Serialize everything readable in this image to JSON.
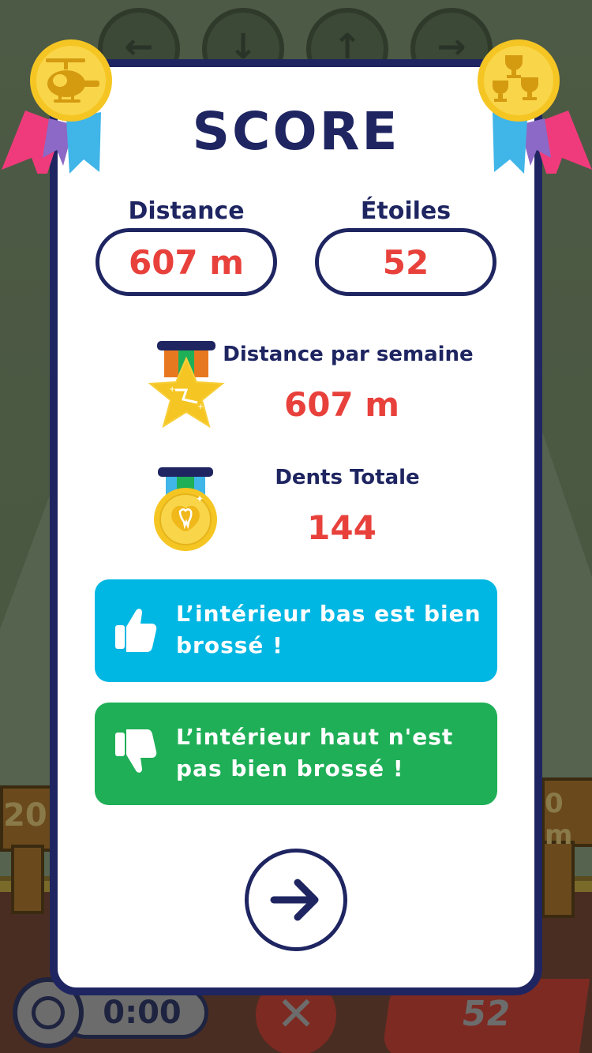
{
  "score_panel": {
    "title": "SCORE",
    "distance_label": "Distance",
    "distance_value": "607 m",
    "stars_label": "Étoiles",
    "stars_value": "52",
    "weekly_label": "Distance par semaine",
    "weekly_value": "607 m",
    "teeth_label": "Dents Totale",
    "teeth_value": "144",
    "feedback_good": "L’intérieur bas est bien brossé !",
    "feedback_bad": "L’intérieur haut n'est pas bien brossé !"
  },
  "background": {
    "timer_text": "0:00",
    "left_marker_text": "20",
    "right_marker_text": "0 m",
    "stars_banner_text": "52"
  },
  "colors": {
    "navy": "#1e2561",
    "red": "#e8413c",
    "good": "#00b7e3",
    "bad": "#1faf57",
    "gold": "#f5c623",
    "pink": "#ef3b7b",
    "blue": "#40b5e8"
  },
  "icons": {
    "left_ribbon": "helicopter-medal-icon",
    "right_ribbon": "trophies-medal-icon",
    "weekly": "star-medal-icon",
    "teeth": "tooth-medal-icon",
    "good": "thumbs-up-icon",
    "bad": "thumbs-down-icon",
    "next": "arrow-right-icon"
  }
}
